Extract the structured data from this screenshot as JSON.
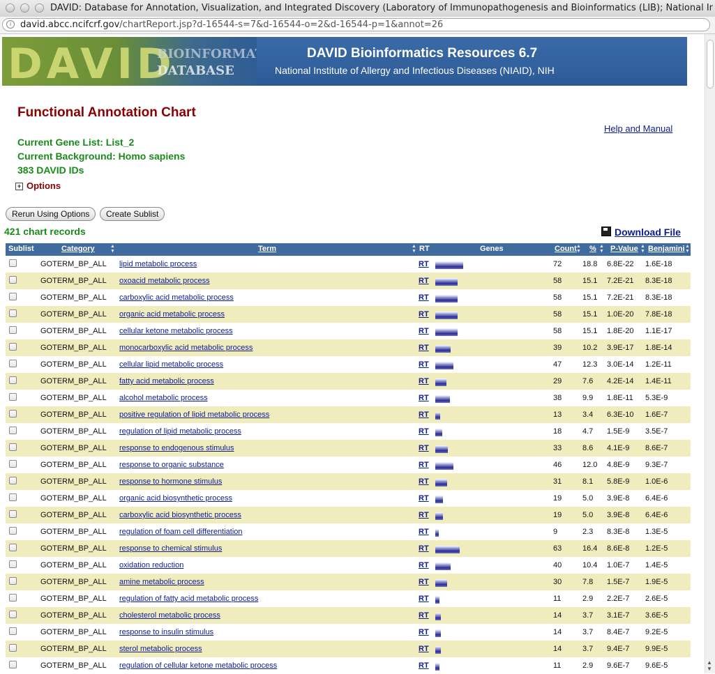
{
  "window": {
    "title": "DAVID: Database for Annotation, Visualization, and Integrated Discovery (Laboratory of Immunopathogenesis and Bioinformatics (LIB); National Ins...",
    "url_host": "david.abcc.ncifcrf.gov",
    "url_path": "/chartReport.jsp?d-16544-s=7&d-16544-o=2&d-16544-p=1&annot=26"
  },
  "banner": {
    "logo_letters": "DAVID",
    "logo_sub1": "BIOINFORMATICS",
    "logo_sub2": "DATABASE",
    "title": "DAVID Bioinformatics Resources 6.7",
    "subtitle": "National Institute of Allergy and Infectious Diseases (NIAID), NIH"
  },
  "page": {
    "title": "Functional Annotation Chart",
    "help_link": "Help and Manual",
    "gene_list": "Current Gene List: List_2",
    "background": "Current Background: Homo sapiens",
    "ids": "383 DAVID IDs",
    "options_label": "Options",
    "rerun_button": "Rerun Using Options",
    "sublist_button": "Create Sublist",
    "records": "421 chart records",
    "download_label": "Download File"
  },
  "table": {
    "headers": {
      "sublist": "Sublist",
      "category": "Category",
      "term": "Term",
      "rt": "RT",
      "genes": "Genes",
      "count": "Count",
      "percent": "%",
      "pvalue": "P-Value",
      "benjamini": "Benjamini"
    },
    "rows": [
      {
        "category": "GOTERM_BP_ALL",
        "term": "lipid metabolic process",
        "rt": "RT",
        "count": "72",
        "percent": "18.8",
        "pvalue": "6.8E-22",
        "benjamini": "1.6E-18",
        "bar": 18.8
      },
      {
        "category": "GOTERM_BP_ALL",
        "term": "oxoacid metabolic process",
        "rt": "RT",
        "count": "58",
        "percent": "15.1",
        "pvalue": "7.2E-21",
        "benjamini": "8.3E-18",
        "bar": 15.1
      },
      {
        "category": "GOTERM_BP_ALL",
        "term": "carboxylic acid metabolic process",
        "rt": "RT",
        "count": "58",
        "percent": "15.1",
        "pvalue": "7.2E-21",
        "benjamini": "8.3E-18",
        "bar": 15.1
      },
      {
        "category": "GOTERM_BP_ALL",
        "term": "organic acid metabolic process",
        "rt": "RT",
        "count": "58",
        "percent": "15.1",
        "pvalue": "1.0E-20",
        "benjamini": "7.8E-18",
        "bar": 15.1
      },
      {
        "category": "GOTERM_BP_ALL",
        "term": "cellular ketone metabolic process",
        "rt": "RT",
        "count": "58",
        "percent": "15.1",
        "pvalue": "1.8E-20",
        "benjamini": "1.1E-17",
        "bar": 15.1
      },
      {
        "category": "GOTERM_BP_ALL",
        "term": "monocarboxylic acid metabolic process",
        "rt": "RT",
        "count": "39",
        "percent": "10.2",
        "pvalue": "3.9E-17",
        "benjamini": "1.8E-14",
        "bar": 10.2
      },
      {
        "category": "GOTERM_BP_ALL",
        "term": "cellular lipid metabolic process",
        "rt": "RT",
        "count": "47",
        "percent": "12.3",
        "pvalue": "3.0E-14",
        "benjamini": "1.2E-11",
        "bar": 12.3
      },
      {
        "category": "GOTERM_BP_ALL",
        "term": "fatty acid metabolic process",
        "rt": "RT",
        "count": "29",
        "percent": "7.6",
        "pvalue": "4.2E-14",
        "benjamini": "1.4E-11",
        "bar": 7.6
      },
      {
        "category": "GOTERM_BP_ALL",
        "term": "alcohol metabolic process",
        "rt": "RT",
        "count": "38",
        "percent": "9.9",
        "pvalue": "1.8E-11",
        "benjamini": "5.3E-9",
        "bar": 9.9
      },
      {
        "category": "GOTERM_BP_ALL",
        "term": "positive regulation of lipid metabolic process",
        "rt": "RT",
        "count": "13",
        "percent": "3.4",
        "pvalue": "6.3E-10",
        "benjamini": "1.6E-7",
        "bar": 3.4
      },
      {
        "category": "GOTERM_BP_ALL",
        "term": "regulation of lipid metabolic process",
        "rt": "RT",
        "count": "18",
        "percent": "4.7",
        "pvalue": "1.5E-9",
        "benjamini": "3.5E-7",
        "bar": 4.7
      },
      {
        "category": "GOTERM_BP_ALL",
        "term": "response to endogenous stimulus",
        "rt": "RT",
        "count": "33",
        "percent": "8.6",
        "pvalue": "4.1E-9",
        "benjamini": "8.6E-7",
        "bar": 8.6
      },
      {
        "category": "GOTERM_BP_ALL",
        "term": "response to organic substance",
        "rt": "RT",
        "count": "46",
        "percent": "12.0",
        "pvalue": "4.8E-9",
        "benjamini": "9.3E-7",
        "bar": 12.0
      },
      {
        "category": "GOTERM_BP_ALL",
        "term": "response to hormone stimulus",
        "rt": "RT",
        "count": "31",
        "percent": "8.1",
        "pvalue": "5.8E-9",
        "benjamini": "1.0E-6",
        "bar": 8.1
      },
      {
        "category": "GOTERM_BP_ALL",
        "term": "organic acid biosynthetic process",
        "rt": "RT",
        "count": "19",
        "percent": "5.0",
        "pvalue": "3.9E-8",
        "benjamini": "6.4E-6",
        "bar": 5.0
      },
      {
        "category": "GOTERM_BP_ALL",
        "term": "carboxylic acid biosynthetic process",
        "rt": "RT",
        "count": "19",
        "percent": "5.0",
        "pvalue": "3.9E-8",
        "benjamini": "6.4E-6",
        "bar": 5.0
      },
      {
        "category": "GOTERM_BP_ALL",
        "term": "regulation of foam cell differentiation",
        "rt": "RT",
        "count": "9",
        "percent": "2.3",
        "pvalue": "8.3E-8",
        "benjamini": "1.3E-5",
        "bar": 2.3
      },
      {
        "category": "GOTERM_BP_ALL",
        "term": "response to chemical stimulus",
        "rt": "RT",
        "count": "63",
        "percent": "16.4",
        "pvalue": "8.6E-8",
        "benjamini": "1.2E-5",
        "bar": 16.4
      },
      {
        "category": "GOTERM_BP_ALL",
        "term": "oxidation reduction",
        "rt": "RT",
        "count": "40",
        "percent": "10.4",
        "pvalue": "1.0E-7",
        "benjamini": "1.4E-5",
        "bar": 10.4
      },
      {
        "category": "GOTERM_BP_ALL",
        "term": "amine metabolic process",
        "rt": "RT",
        "count": "30",
        "percent": "7.8",
        "pvalue": "1.5E-7",
        "benjamini": "1.9E-5",
        "bar": 7.8
      },
      {
        "category": "GOTERM_BP_ALL",
        "term": "regulation of fatty acid metabolic process",
        "rt": "RT",
        "count": "11",
        "percent": "2.9",
        "pvalue": "2.2E-7",
        "benjamini": "2.6E-5",
        "bar": 2.9
      },
      {
        "category": "GOTERM_BP_ALL",
        "term": "cholesterol metabolic process",
        "rt": "RT",
        "count": "14",
        "percent": "3.7",
        "pvalue": "3.1E-7",
        "benjamini": "3.6E-5",
        "bar": 3.7
      },
      {
        "category": "GOTERM_BP_ALL",
        "term": "response to insulin stimulus",
        "rt": "RT",
        "count": "14",
        "percent": "3.7",
        "pvalue": "8.4E-7",
        "benjamini": "9.2E-5",
        "bar": 3.7
      },
      {
        "category": "GOTERM_BP_ALL",
        "term": "sterol metabolic process",
        "rt": "RT",
        "count": "14",
        "percent": "3.7",
        "pvalue": "9.4E-7",
        "benjamini": "9.9E-5",
        "bar": 3.7
      },
      {
        "category": "GOTERM_BP_ALL",
        "term": "regulation of cellular ketone metabolic process",
        "rt": "RT",
        "count": "11",
        "percent": "2.9",
        "pvalue": "9.6E-7",
        "benjamini": "9.6E-5",
        "bar": 2.9
      }
    ]
  },
  "colors": {
    "header_bg": "#3f6b9e",
    "alt_row": "#f0ecbe",
    "title_red": "#8b0000",
    "info_green": "#1a8a1a",
    "link_blue": "#0b1d8f"
  }
}
